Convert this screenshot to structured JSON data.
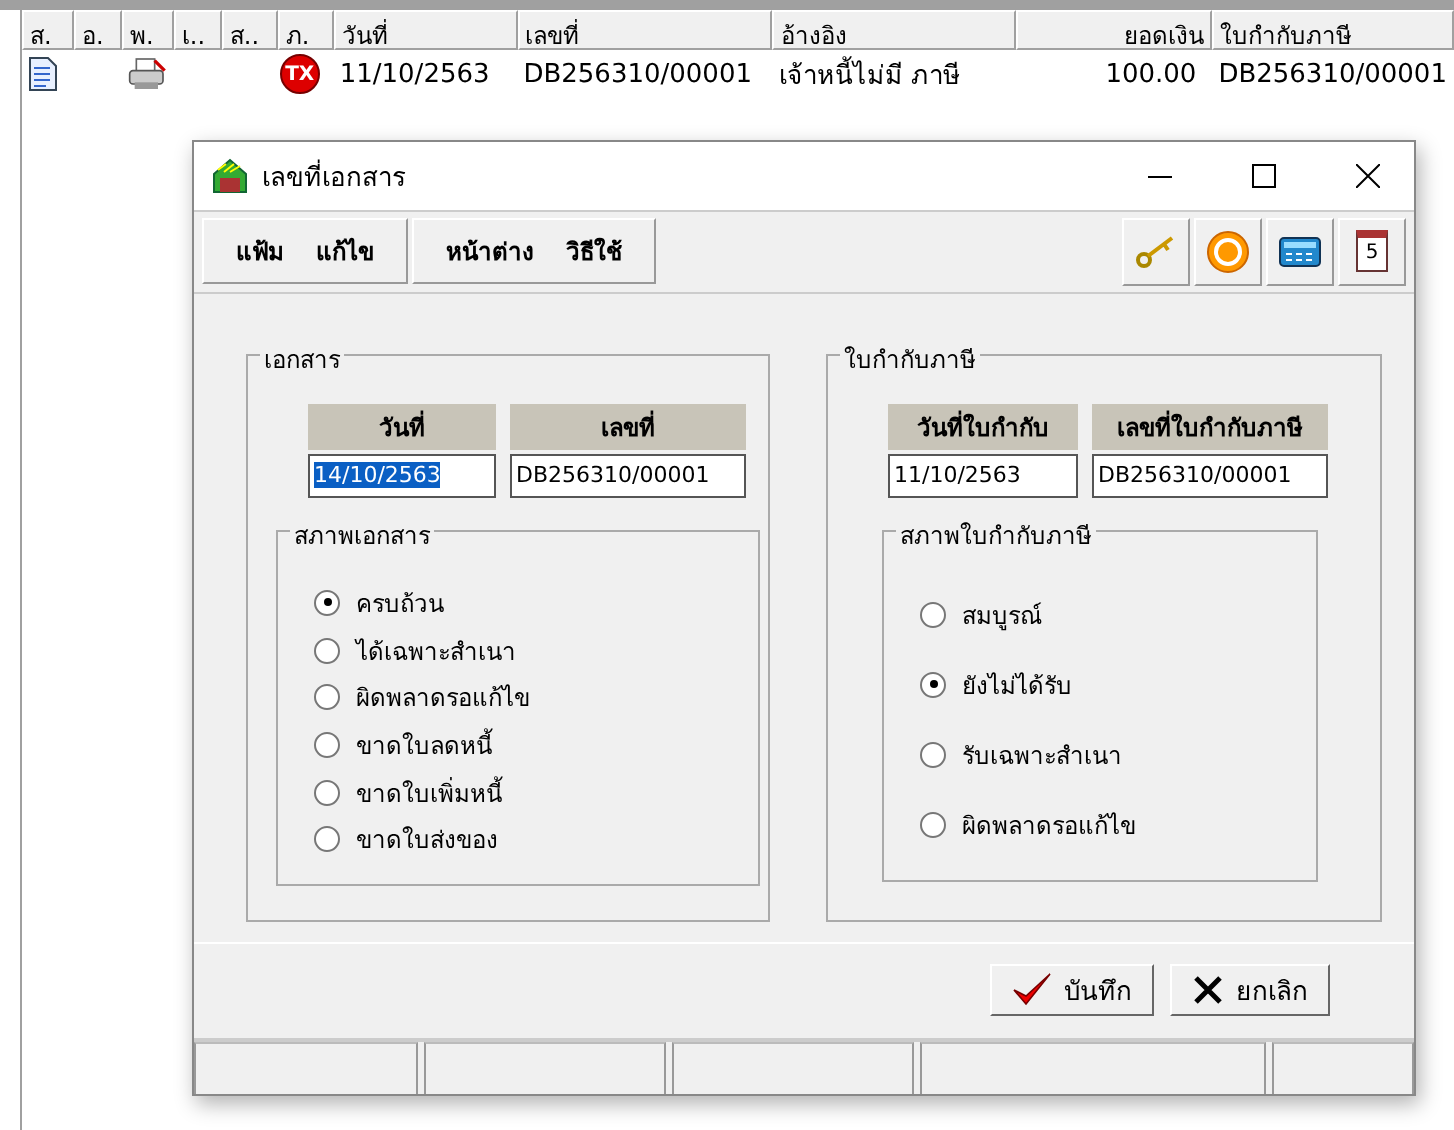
{
  "table": {
    "columns": [
      "ส.",
      "อ.",
      "พ.",
      "เ..",
      "ส..",
      "ภ.",
      "วันที่",
      "เลขที่",
      "อ้างอิง",
      "ยอดเงิน",
      "ใบกำกับภาษี"
    ],
    "rows": [
      {
        "cells": [
          {
            "kind": "doc-icon"
          },
          {
            "kind": "empty"
          },
          {
            "kind": "printer-icon"
          },
          {
            "kind": "empty"
          },
          {
            "kind": "empty"
          },
          {
            "kind": "badge",
            "text": "TX"
          },
          {
            "kind": "text",
            "text": "11/10/2563"
          },
          {
            "kind": "text",
            "text": "DB256310/00001"
          },
          {
            "kind": "text",
            "text": "เจ้าหนี้ไม่มี ภาษี"
          },
          {
            "kind": "amount",
            "text": "100.00"
          },
          {
            "kind": "text",
            "text": "DB256310/00001"
          }
        ]
      }
    ]
  },
  "dialog": {
    "title": "เลขที่เอกสาร",
    "calendar_day": "5",
    "menu_groups": [
      [
        "แฟ้ม",
        "แก้ไข"
      ],
      [
        "หน้าต่าง",
        "วิธีใช้"
      ]
    ],
    "document": {
      "title": "เอกสาร",
      "fields": [
        {
          "label": "วันที่",
          "value": "14/10/2563",
          "text_selected": true
        },
        {
          "label": "เลขที่",
          "value": "DB256310/00001",
          "text_selected": false
        }
      ],
      "status": {
        "title": "สภาพเอกสาร",
        "options": [
          {
            "label": "ครบถ้วน",
            "selected": true
          },
          {
            "label": "ได้เฉพาะสำเนา",
            "selected": false
          },
          {
            "label": "ผิดพลาดรอแก้ไข",
            "selected": false
          },
          {
            "label": "ขาดใบลดหนี้",
            "selected": false
          },
          {
            "label": "ขาดใบเพิ่มหนี้",
            "selected": false
          },
          {
            "label": "ขาดใบส่งของ",
            "selected": false
          }
        ]
      }
    },
    "tax_invoice": {
      "title": "ใบกำกับภาษี",
      "fields": [
        {
          "label": "วันที่ใบกำกับ",
          "value": "11/10/2563",
          "text_selected": false
        },
        {
          "label": "เลขที่ใบกำกับภาษี",
          "value": "DB256310/00001",
          "text_selected": false
        }
      ],
      "status": {
        "title": "สภาพใบกำกับภาษี",
        "options": [
          {
            "label": "สมบูรณ์",
            "selected": false
          },
          {
            "label": "ยังไม่ได้รับ",
            "selected": true
          },
          {
            "label": "รับเฉพาะสำเนา",
            "selected": false
          },
          {
            "label": "ผิดพลาดรอแก้ไข",
            "selected": false
          }
        ]
      }
    },
    "buttons": [
      {
        "kind": "save",
        "label": "บันทึก"
      },
      {
        "kind": "cancel",
        "label": "ยกเลิก"
      }
    ]
  }
}
